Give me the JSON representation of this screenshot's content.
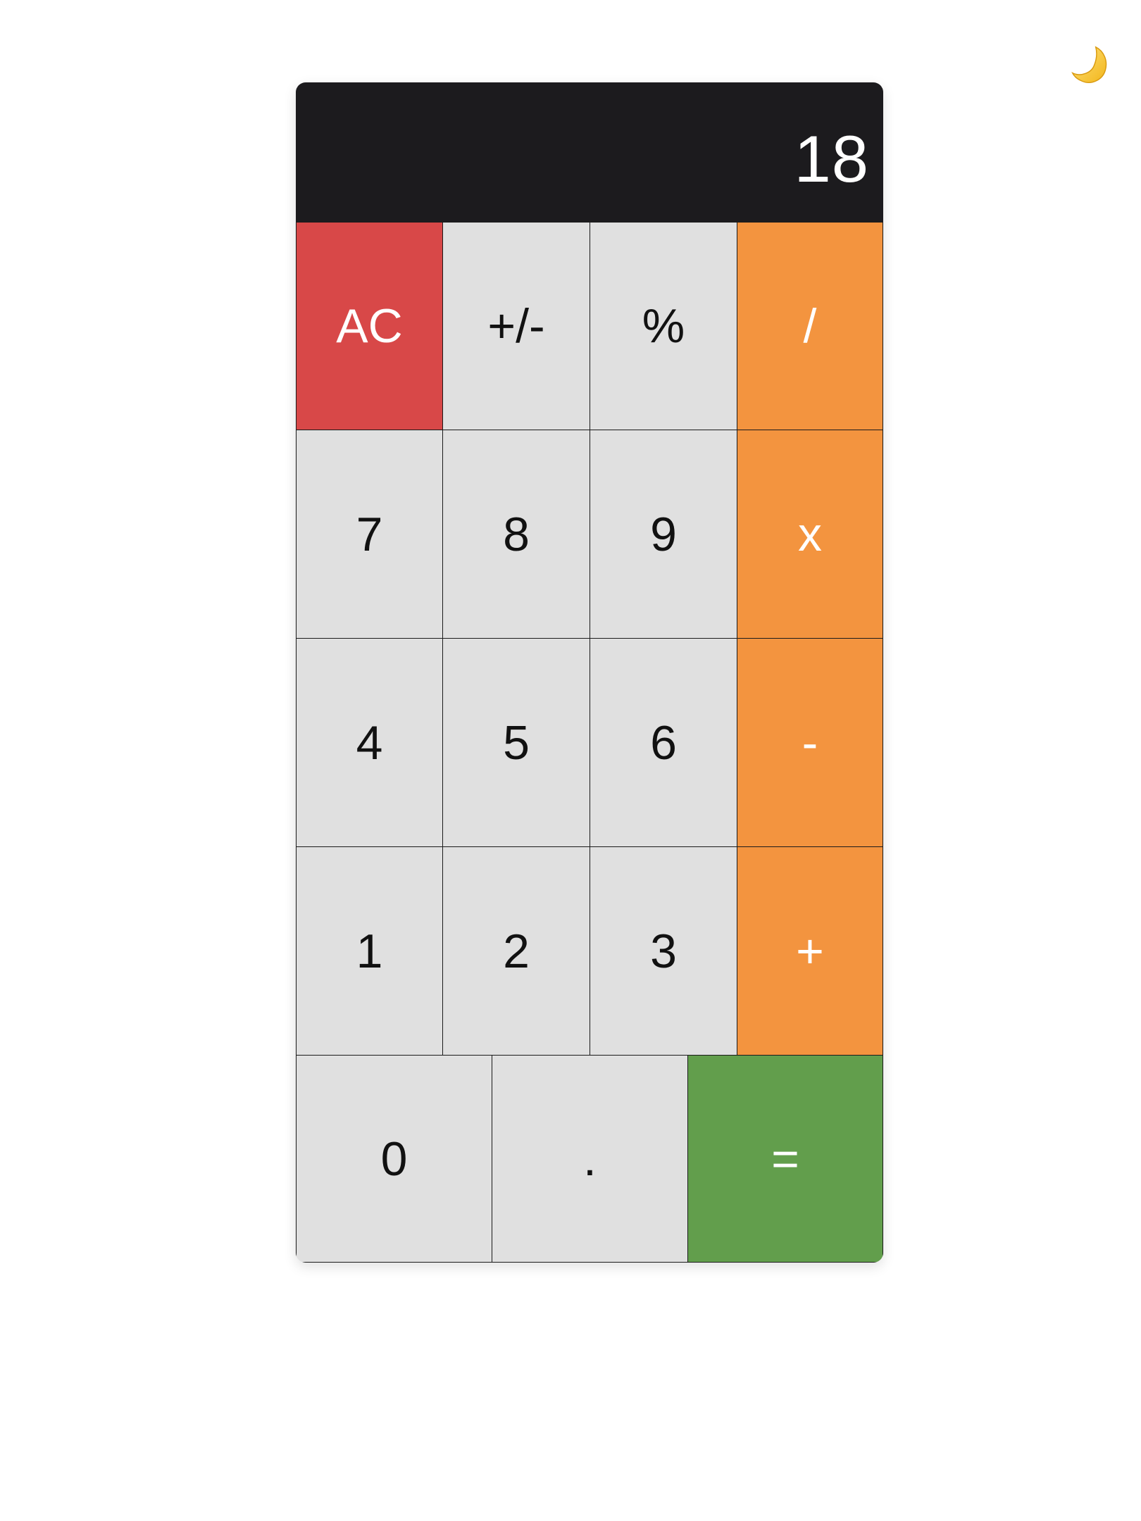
{
  "theme_toggle": {
    "icon": "crescent-moon-icon"
  },
  "display": {
    "value": "18"
  },
  "colors": {
    "display_bg": "#1c1b1e",
    "key_bg": "#e0e0e0",
    "clear": "#d84848",
    "operator": "#f3943f",
    "equals": "#629e4c"
  },
  "keys": {
    "clear": "AC",
    "sign": "+/-",
    "percent": "%",
    "divide": "/",
    "seven": "7",
    "eight": "8",
    "nine": "9",
    "multiply": "x",
    "four": "4",
    "five": "5",
    "six": "6",
    "subtract": "-",
    "one": "1",
    "two": "2",
    "three": "3",
    "add": "+",
    "zero": "0",
    "decimal": ".",
    "equals": "="
  }
}
